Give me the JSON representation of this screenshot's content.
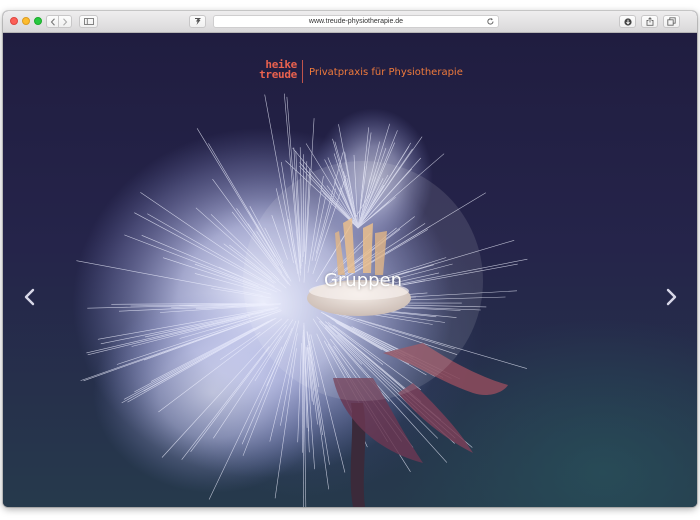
{
  "browser": {
    "url": "www.treude-physiotherapie.de",
    "icons": [
      "close-icon",
      "minimize-icon",
      "zoom-icon",
      "chevron-left-icon",
      "chevron-right-icon",
      "sidebar-icon",
      "extension-icon",
      "reload-icon",
      "download-icon",
      "share-icon",
      "tabs-icon"
    ]
  },
  "site": {
    "logo": {
      "line1": "heike",
      "line2": "treude"
    },
    "tagline": "Privatpraxis für Physiotherapie"
  },
  "slider": {
    "caption": "Gruppen",
    "prev_icon": "chevron-left-icon",
    "next_icon": "chevron-right-icon"
  },
  "colors": {
    "brand_red": "#e9614e",
    "brand_orange": "#ef7a3c",
    "background": "#201d40"
  }
}
